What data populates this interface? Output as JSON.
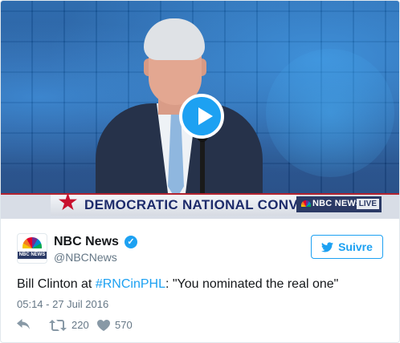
{
  "media": {
    "banner_text": "DEMOCRATIC NATIONAL CONVENTION",
    "network_label": "NBC NEWS",
    "live_label": "LIVE"
  },
  "author": {
    "name": "NBC News",
    "handle": "@NBCNews",
    "avatar_text": "NBC NEWS",
    "verified": true
  },
  "follow_button": {
    "label": "Suivre",
    "icon": "twitter-bird-icon"
  },
  "tweet": {
    "text_before": "Bill Clinton at ",
    "hashtag": "#RNCinPHL",
    "text_after": ": \"You nominated the real one\"",
    "timestamp": "05:14 - 27 Juil 2016"
  },
  "actions": {
    "reply_icon": "reply-icon",
    "retweet_icon": "retweet-icon",
    "retweet_count": "220",
    "like_icon": "heart-icon",
    "like_count": "570"
  },
  "colors": {
    "accent": "#1da1f2",
    "text": "#14171a",
    "muted": "#657786",
    "banner_red": "#c8102e",
    "banner_blue": "#1d2b6b"
  }
}
